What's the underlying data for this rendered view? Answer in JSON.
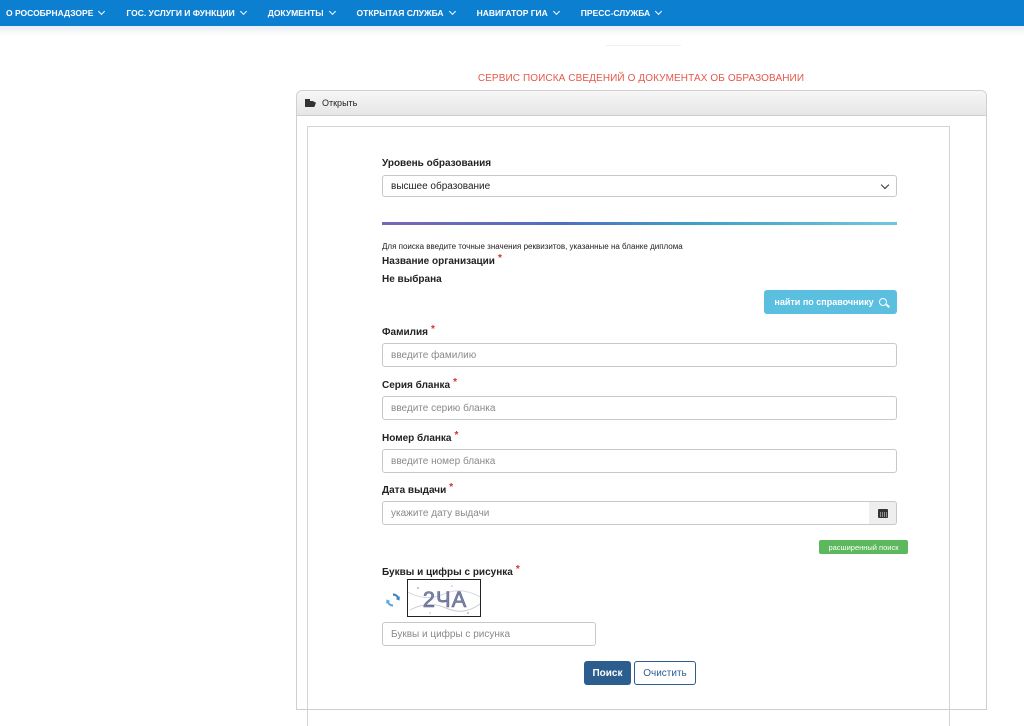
{
  "nav": {
    "items": [
      {
        "label": "О Рособрнадзоре"
      },
      {
        "label": "Гос. услуги и функции"
      },
      {
        "label": "Документы"
      },
      {
        "label": "Открытая служба"
      },
      {
        "label": "Навигатор ГИА"
      },
      {
        "label": "Пресс-служба"
      }
    ]
  },
  "service_title": "СЕРВИС ПОИСКА СВЕДЕНИЙ О ДОКУМЕНТАХ ОБ ОБРАЗОВАНИИ",
  "panel": {
    "header_label": "Открыть"
  },
  "form": {
    "level_label": "Уровень образования",
    "level_value": "высшее образование",
    "hint": "Для поиска введите точные значения реквизитов, указанные на бланке диплома",
    "org_label": "Название организации",
    "org_value": "Не выбрана",
    "lookup_button": "найти по справочнику",
    "surname_label": "Фамилия",
    "surname_placeholder": "введите фамилию",
    "series_label": "Серия бланка",
    "series_placeholder": "введите серию бланка",
    "number_label": "Номер бланка",
    "number_placeholder": "введите номер бланка",
    "date_label": "Дата выдачи",
    "date_placeholder": "укажите дату выдачи",
    "advanced_button": "расширенный поиск",
    "captcha_label": "Буквы и цифры с рисунка",
    "captcha_text": "2ЧА",
    "captcha_placeholder": "Буквы и цифры с рисунка",
    "search_button": "Поиск",
    "clear_button": "Очистить",
    "required_mark": "*"
  },
  "colors": {
    "nav_bg": "#0d7fd1",
    "title_red": "#e5574a",
    "lookup_btn": "#5bbfe0",
    "advanced_btn": "#5cb85c",
    "primary_btn": "#2c5d8f"
  }
}
